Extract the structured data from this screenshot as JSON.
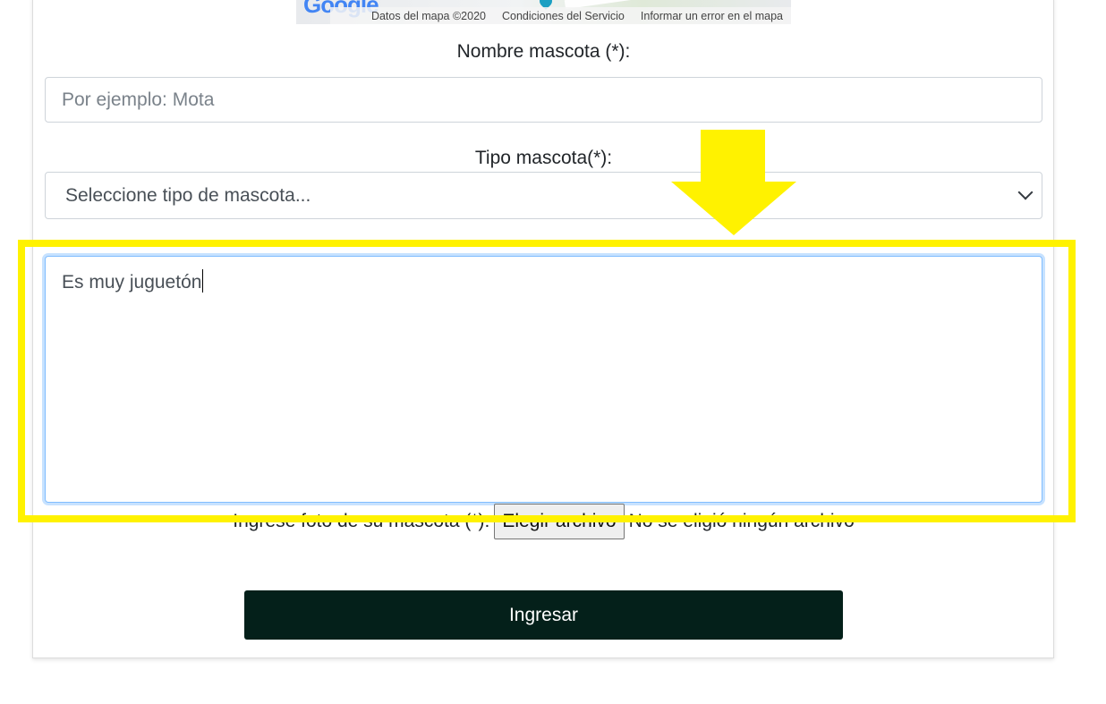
{
  "map": {
    "logo_text": "Google",
    "footer": [
      "Datos del mapa ©2020",
      "Condiciones del Servicio",
      "Informar un error en el mapa"
    ]
  },
  "form": {
    "name_label": "Nombre mascota (*):",
    "name_placeholder": "Por ejemplo: Mota",
    "name_value": "",
    "type_label": "Tipo mascota(*):",
    "type_selected": "Seleccione tipo de mascota...",
    "description_value": "Es muy juguetón",
    "photo_label": "Ingrese foto de su mascota (*):",
    "file_button": "Elegir archivo",
    "file_status": "No se eligió ningún archivo",
    "submit_label": "Ingresar"
  },
  "annotation": {
    "highlight_color": "#fff200",
    "arrow_icon": "down-arrow-icon"
  },
  "colors": {
    "submit_bg": "#04201a",
    "focus_border": "#80bdff"
  }
}
